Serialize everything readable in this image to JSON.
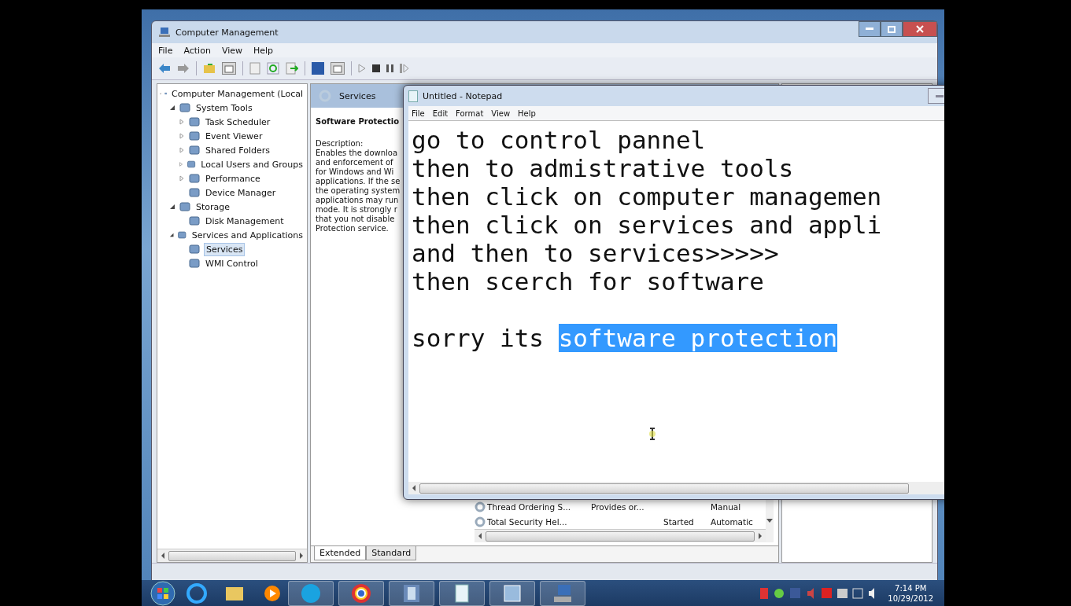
{
  "management_window": {
    "title": "Computer Management",
    "menu": [
      "File",
      "Action",
      "View",
      "Help"
    ],
    "tree": [
      {
        "label": "Computer Management (Local",
        "kind": "folder",
        "expanded": true,
        "selected": false,
        "children": [
          {
            "label": "System Tools",
            "kind": "folder",
            "expanded": true,
            "selected": false,
            "children": [
              {
                "label": "Task Scheduler",
                "kind": "folder",
                "expanded": false,
                "selected": false
              },
              {
                "label": "Event Viewer",
                "kind": "folder",
                "expanded": false,
                "selected": false
              },
              {
                "label": "Shared Folders",
                "kind": "folder",
                "expanded": false,
                "selected": false
              },
              {
                "label": "Local Users and Groups",
                "kind": "folder",
                "expanded": false,
                "selected": false
              },
              {
                "label": "Performance",
                "kind": "folder",
                "expanded": false,
                "selected": false
              },
              {
                "label": "Device Manager",
                "kind": "leaf",
                "selected": false
              }
            ]
          },
          {
            "label": "Storage",
            "kind": "folder",
            "expanded": true,
            "selected": false,
            "children": [
              {
                "label": "Disk Management",
                "kind": "leaf",
                "selected": false
              }
            ]
          },
          {
            "label": "Services and Applications",
            "kind": "folder",
            "expanded": true,
            "selected": false,
            "children": [
              {
                "label": "Services",
                "kind": "leaf",
                "selected": true
              },
              {
                "label": "WMI Control",
                "kind": "leaf",
                "selected": false
              }
            ]
          }
        ]
      }
    ],
    "pane_header": "Services",
    "service_name": "Software Protectio",
    "description_label": "Description:",
    "description_lines": [
      "Enables the downloa",
      "and enforcement of",
      "for Windows and Wi",
      "applications. If the se",
      "the operating system",
      "applications may run",
      "mode. It is strongly r",
      "that you not disable",
      "Protection service."
    ],
    "service_rows": [
      [
        "Thread Ordering S...",
        "Provides or...",
        "",
        "Manual"
      ],
      [
        "Total Security Hel...",
        "",
        "Started",
        "Automatic"
      ]
    ],
    "view_tabs": [
      {
        "label": "Extended",
        "selected": true
      },
      {
        "label": "Standard",
        "selected": false
      }
    ]
  },
  "notepad": {
    "title": "Untitled - Notepad",
    "menu": [
      "File",
      "Edit",
      "Format",
      "View",
      "Help"
    ],
    "lines": [
      {
        "kind": "text",
        "segments": [
          {
            "text": "go to control pannel",
            "selected": false
          }
        ]
      },
      {
        "kind": "text",
        "segments": [
          {
            "text": "then to admistrative tools",
            "selected": false
          }
        ]
      },
      {
        "kind": "text",
        "segments": [
          {
            "text": "then click on computer managemen",
            "selected": false
          }
        ]
      },
      {
        "kind": "text",
        "segments": [
          {
            "text": "then click on services and appli",
            "selected": false
          }
        ]
      },
      {
        "kind": "text",
        "segments": [
          {
            "text": "and then to services>>>>>",
            "selected": false
          }
        ]
      },
      {
        "kind": "text",
        "segments": [
          {
            "text": "then scerch for software",
            "selected": false
          }
        ]
      },
      {
        "kind": "blank"
      },
      {
        "kind": "text",
        "segments": [
          {
            "text": "sorry its ",
            "selected": false
          },
          {
            "text": "software protection",
            "selected": true
          }
        ]
      }
    ]
  },
  "taskbar": {
    "time": "7:14 PM",
    "date": "10/29/2012"
  }
}
